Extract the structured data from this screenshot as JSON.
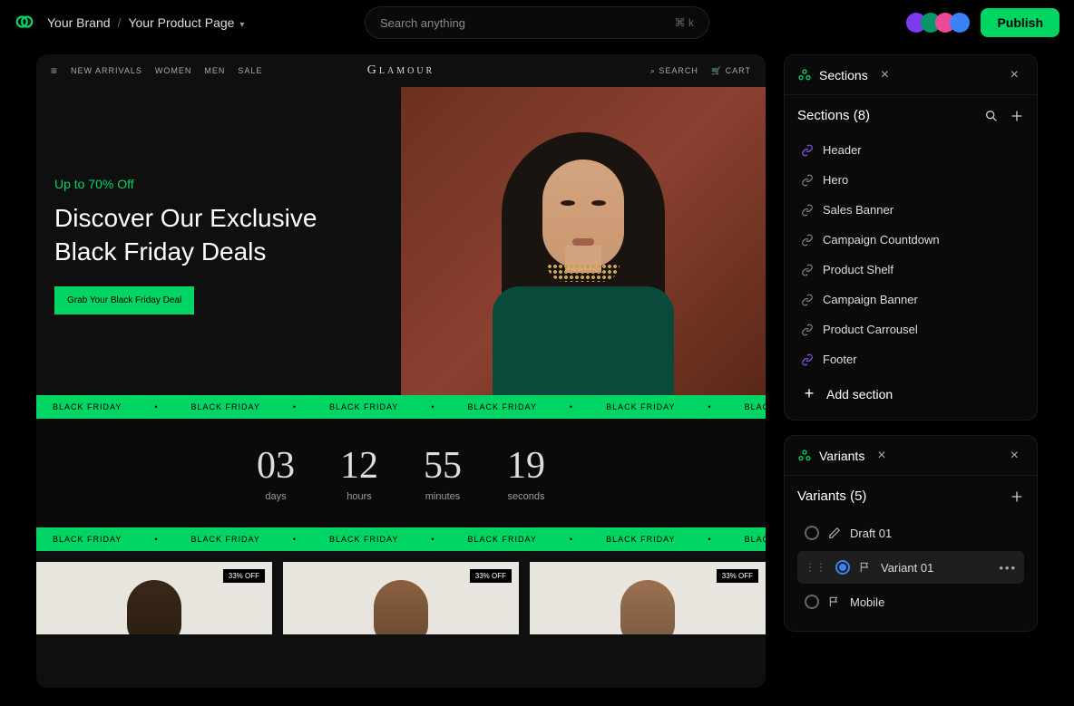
{
  "breadcrumb": {
    "brand": "Your Brand",
    "page": "Your Product Page"
  },
  "search": {
    "placeholder": "Search anything",
    "shortcut": "⌘ k"
  },
  "publish": "Publish",
  "preview": {
    "nav": {
      "new_arrivals": "NEW ARRIVALS",
      "women": "WOMEN",
      "men": "MEN",
      "sale": "SALE"
    },
    "logo": "Glamour",
    "search_label": "SEARCH",
    "cart_label": "CART",
    "hero": {
      "subtitle": "Up to 70% Off",
      "title_l1": "Discover Our Exclusive",
      "title_l2": "Black Friday Deals",
      "cta": "Grab Your Black Friday Deal"
    },
    "marquee_text": "BLACK FRIDAY",
    "countdown": [
      {
        "value": "03",
        "label": "days"
      },
      {
        "value": "12",
        "label": "hours"
      },
      {
        "value": "55",
        "label": "minutes"
      },
      {
        "value": "19",
        "label": "seconds"
      }
    ],
    "product_badge": "33% OFF"
  },
  "sections_panel": {
    "tab": "Sections",
    "heading": "Sections (8)",
    "items": [
      {
        "label": "Header",
        "accent": true
      },
      {
        "label": "Hero",
        "accent": false
      },
      {
        "label": "Sales Banner",
        "accent": false
      },
      {
        "label": "Campaign Countdown",
        "accent": false
      },
      {
        "label": "Product Shelf",
        "accent": false
      },
      {
        "label": "Campaign Banner",
        "accent": false
      },
      {
        "label": "Product Carrousel",
        "accent": false
      },
      {
        "label": "Footer",
        "accent": true
      }
    ],
    "add": "Add section"
  },
  "variants_panel": {
    "tab": "Variants",
    "heading": "Variants (5)",
    "items": [
      {
        "label": "Draft 01",
        "icon": "pencil",
        "selected": false,
        "drag": false
      },
      {
        "label": "Variant 01",
        "icon": "flag",
        "selected": true,
        "drag": true
      },
      {
        "label": "Mobile",
        "icon": "flag",
        "selected": false,
        "drag": false
      }
    ]
  }
}
